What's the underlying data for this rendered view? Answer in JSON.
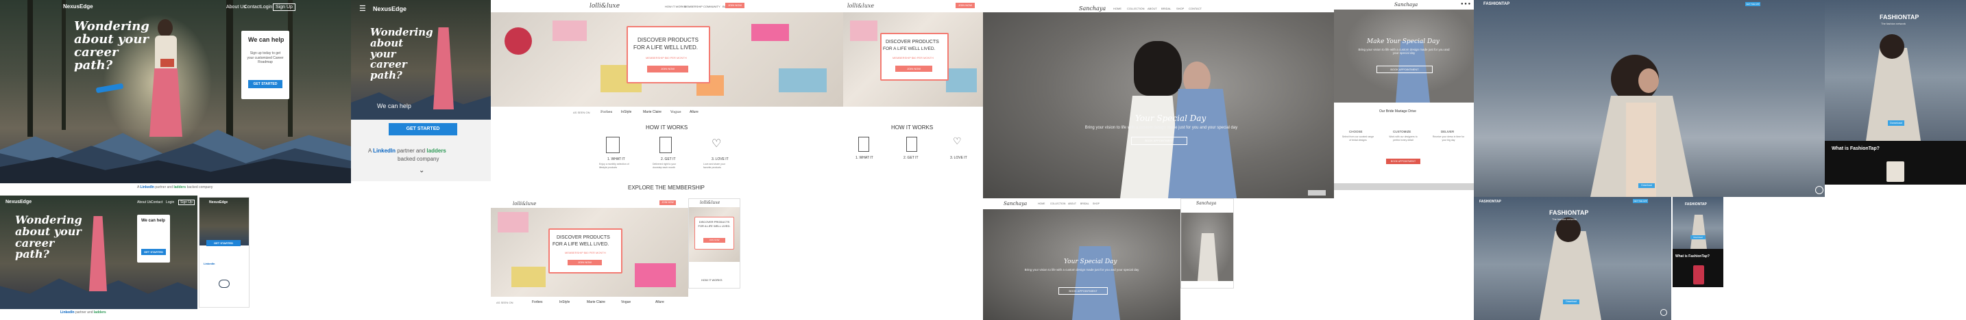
{
  "nexus": {
    "brand": "NexusEdge",
    "nav": [
      "About Us",
      "Contact",
      "Login",
      "Sign Up"
    ],
    "headline": "Wondering about your career path?",
    "card_title": "We can help",
    "card_text": "Sign up today to get your customized Career Roadmap",
    "cta": "GET STARTED",
    "partner_line_prefix": "A",
    "partner_linkedin": "LinkedIn",
    "partner_line_mid": "partner and",
    "partner_ladders": "ladders",
    "partner_line_suffix": "backed company",
    "colors": {
      "accent": "#1f84d8",
      "dark": "#1c1f24"
    }
  },
  "lolli": {
    "brand": "lolli&luxe",
    "nav": [
      "HOW IT WORKS",
      "MEMBERSHIP",
      "COMMUNITY",
      "BLOG",
      "SIGN IN"
    ],
    "nav_cta": "JOIN NOW",
    "hero_title_1": "DISCOVER PRODUCTS",
    "hero_title_2": "FOR A LIFE WELL LIVED.",
    "hero_sub": "MEMBERSHIP $60 PER MONTH",
    "hero_cta": "JOIN NOW",
    "press_label": "AS SEEN ON",
    "press": [
      "Forbes",
      "InStyle",
      "Marie Claire",
      "Vogue",
      "Allure"
    ],
    "how_title": "HOW IT WORKS",
    "steps": [
      {
        "title": "1. WHAT IT",
        "text": "Enjoy a monthly selection of lifestyle products"
      },
      {
        "title": "2. GET IT",
        "text": "Delivered right to your doorstep each month"
      },
      {
        "title": "3. LOVE IT",
        "text": "Love and share your favorite products"
      }
    ],
    "explore": "EXPLORE THE MEMBERSHIP",
    "how_small": "HOW IT WORKS",
    "colors": {
      "accent": "#f37b72"
    }
  },
  "bridal": {
    "brand": "Sanchaya",
    "nav": [
      "HOME",
      "COLLECTION",
      "ABOUT",
      "BRIDAL",
      "SHOP",
      "CONTACT"
    ],
    "headline": "Your Special Day",
    "sub": "Bring your vision to life with a custom design made just for you and your special day",
    "cta": "BOOK APPOINTMENT",
    "mobile_title": "Make Your Special Day",
    "process_title": "Our Bride Mariage Drive",
    "process": [
      {
        "title": "CHOOSE",
        "text": "Select from our curated range of bridal designs"
      },
      {
        "title": "CUSTOMIZE",
        "text": "Work with our designers to perfect every detail"
      },
      {
        "title": "DELIVER",
        "text": "Receive your dress in time for your big day"
      }
    ],
    "process_cta": "BOOK APPOINTMENT"
  },
  "fashion": {
    "brand": "FASHIONTAP",
    "tagline": "The fashion network",
    "nav_cta": "GET THE APP",
    "section_title": "What is FashionTap?",
    "app_cta": "Download",
    "colors": {
      "accent": "#3aa3e3"
    }
  }
}
